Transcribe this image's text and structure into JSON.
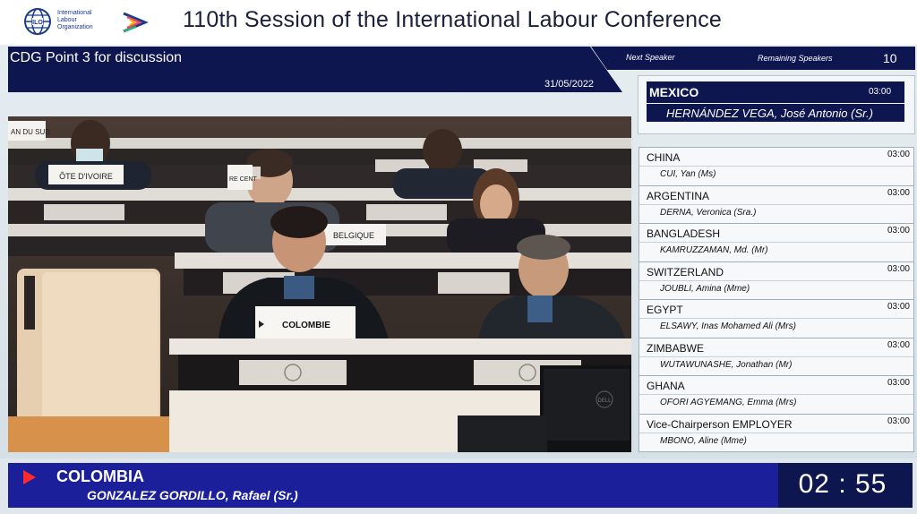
{
  "header": {
    "org_name": "International Labour Organization",
    "title": "110th Session of the International Labour Conference"
  },
  "agenda": {
    "title": "CDG Point 3 for discussion",
    "date": "31/05/2022"
  },
  "next": {
    "label": "Next Speaker",
    "remaining_label": "Remaining Speakers",
    "remaining_count": "10",
    "country": "MEXICO",
    "time": "03:00",
    "name": "HERNÁNDEZ VEGA, José Antonio (Sr.)"
  },
  "speakers": [
    {
      "country": "CHINA",
      "time": "03:00",
      "name": "CUI, Yan (Ms)"
    },
    {
      "country": "ARGENTINA",
      "time": "03:00",
      "name": "DERNA, Veronica (Sra.)"
    },
    {
      "country": "BANGLADESH",
      "time": "03:00",
      "name": "KAMRUZZAMAN, Md. (Mr)"
    },
    {
      "country": "SWITZERLAND",
      "time": "03:00",
      "name": "JOUBLI, Amina (Mme)"
    },
    {
      "country": "EGYPT",
      "time": "03:00",
      "name": "ELSAWY, Inas Mohamed Ali (Mrs)"
    },
    {
      "country": "ZIMBABWE",
      "time": "03:00",
      "name": "WUTAWUNASHE, Jonathan (Mr)"
    },
    {
      "country": "GHANA",
      "time": "03:00",
      "name": "OFORI AGYEMANG, Emma (Mrs)"
    },
    {
      "country": "Vice-Chairperson EMPLOYER",
      "time": "03:00",
      "name": "MBONO, Aline (Mme)"
    }
  ],
  "video": {
    "placards": [
      "ÔTE D'IVOIRE",
      "BELGIQUE",
      "COLOMBIE",
      "AN DU SUD",
      "RE CENT"
    ],
    "monitor_brand": "DELL"
  },
  "current": {
    "country": "COLOMBIA",
    "name": "GONZALEZ GORDILLO, Rafael (Sr.)",
    "timer": "02 : 55"
  },
  "colors": {
    "navy": "#0e1650",
    "bottom_bar": "#1b1f99",
    "accent_red": "#ff2a2a",
    "ilo_blue": "#1a3a8c"
  }
}
